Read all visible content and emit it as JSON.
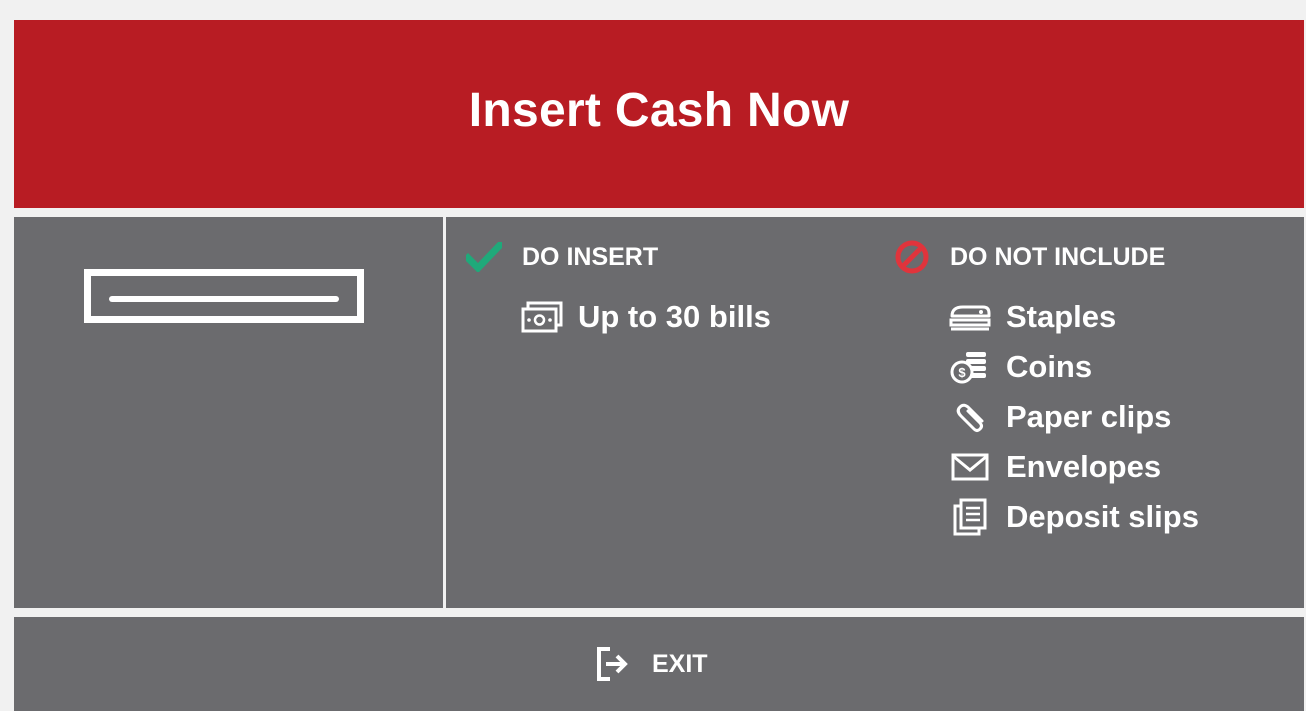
{
  "header": {
    "title": "Insert Cash Now"
  },
  "slot": {
    "icon": "bill-slot-icon"
  },
  "do_insert": {
    "heading": "DO INSERT",
    "icon": "checkmark-icon",
    "icon_color": "#1fa97a",
    "items": [
      {
        "label": "Up to 30 bills",
        "icon": "banknote-icon"
      }
    ]
  },
  "do_not_include": {
    "heading": "DO NOT INCLUDE",
    "icon": "prohibited-icon",
    "icon_color": "#e0343c",
    "items": [
      {
        "label": "Staples",
        "icon": "stapler-icon"
      },
      {
        "label": "Coins",
        "icon": "coins-icon"
      },
      {
        "label": "Paper clips",
        "icon": "paperclip-icon"
      },
      {
        "label": "Envelopes",
        "icon": "envelope-icon"
      },
      {
        "label": "Deposit slips",
        "icon": "deposit-slip-icon"
      }
    ]
  },
  "footer": {
    "exit_label": "EXIT",
    "exit_icon": "exit-icon"
  },
  "colors": {
    "header_bg": "#b81c23",
    "panel_bg": "#6b6b6e",
    "page_bg": "#f1f1f1",
    "text": "#ffffff"
  }
}
